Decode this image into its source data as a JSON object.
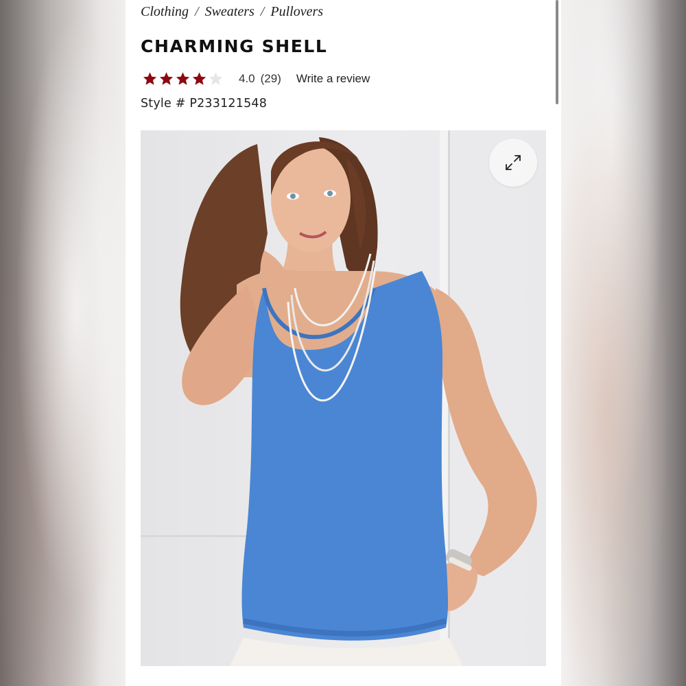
{
  "breadcrumb": {
    "items": [
      "Clothing",
      "Sweaters",
      "Pullovers"
    ],
    "separator": "/"
  },
  "product": {
    "title": "CHARMING SHELL",
    "rating": {
      "value": 4.0,
      "value_text": "4.0",
      "count_text": "(29)",
      "max_stars": 5,
      "filled_stars": 4
    },
    "write_review_label": "Write a review",
    "style_number": "Style # P233121548",
    "image": {
      "subject": "model wearing sleeveless blue knit shell top with layered silver necklaces and white pants",
      "top_color": "#4a86d4"
    }
  },
  "icons": {
    "expand": "expand-arrows-icon",
    "star": "star-icon"
  },
  "colors": {
    "star_filled": "#8b0a12",
    "star_empty": "#e6e6e6",
    "text": "#111111"
  }
}
